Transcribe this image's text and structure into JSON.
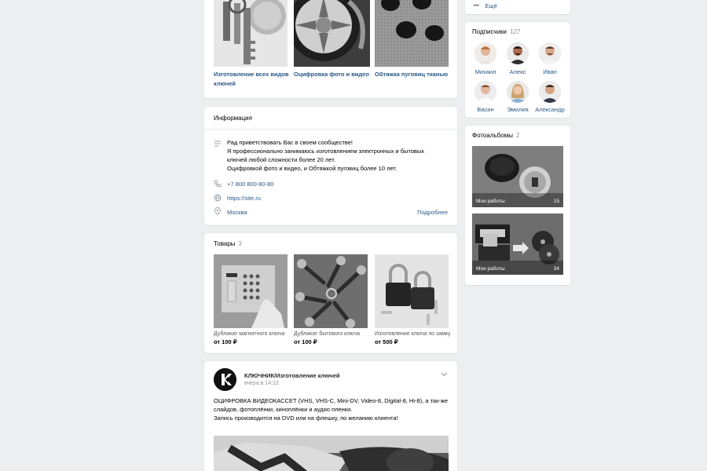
{
  "services": {
    "items": [
      {
        "label": "Изготовление всех видов ключей"
      },
      {
        "label": "Оцифровка фото и видео"
      },
      {
        "label": "Обтяжка пуговиц тканью"
      }
    ]
  },
  "menu_more": "Ещё",
  "info": {
    "title": "Информация",
    "description": [
      "Рад приветствовать Вас в своем сообществе!",
      "Я профессионально занимаюсь изготовлением электронных и бытовых",
      "ключей любой сложности более 20 лет.",
      "Оцифровкой фото и видео, и Обтяжкой пуговиц более 10 лет."
    ],
    "phone": "+7 800 800-80-80",
    "site": "https://site.ru",
    "city": "Москва",
    "more": "Подробнее"
  },
  "goods": {
    "title": "Товары",
    "count": "3",
    "items": [
      {
        "name": "Дубликат магнитного ключа",
        "price": "от 100 ₽"
      },
      {
        "name": "Дубликат бытового ключа",
        "price": "от 100 ₽"
      },
      {
        "name": "Изготовление ключа по замку",
        "price": "от 500 ₽"
      }
    ]
  },
  "post": {
    "author": "КЛЮЧНИК/Изготовление ключей",
    "time": "вчера в 14:22",
    "text": [
      "ОЦИФРОВКА ВИДЕОКАССЕТ (VHS, VHS-C, Mini-DV, Video-8, Digital-8, Hi-8), а так-же",
      "слайдов, фотоплёнки, киноплёнки и аудио пленки.",
      "Запись производится на DVD или на флешку, по желанию клиента!"
    ]
  },
  "subscribers": {
    "title": "Подписчики",
    "count": "127",
    "people": [
      {
        "name": "Михаил"
      },
      {
        "name": "Алекс"
      },
      {
        "name": "Иван"
      },
      {
        "name": "Васин"
      },
      {
        "name": "Эмилия"
      },
      {
        "name": "Александр"
      }
    ]
  },
  "albums": {
    "title": "Фотоальбомы",
    "count": "2",
    "items": [
      {
        "name": "Мои работы",
        "count": "15"
      },
      {
        "name": "Мои работы",
        "count": "34"
      }
    ]
  },
  "colors": {
    "link": "#2a5885",
    "bg": "#edeef0"
  }
}
